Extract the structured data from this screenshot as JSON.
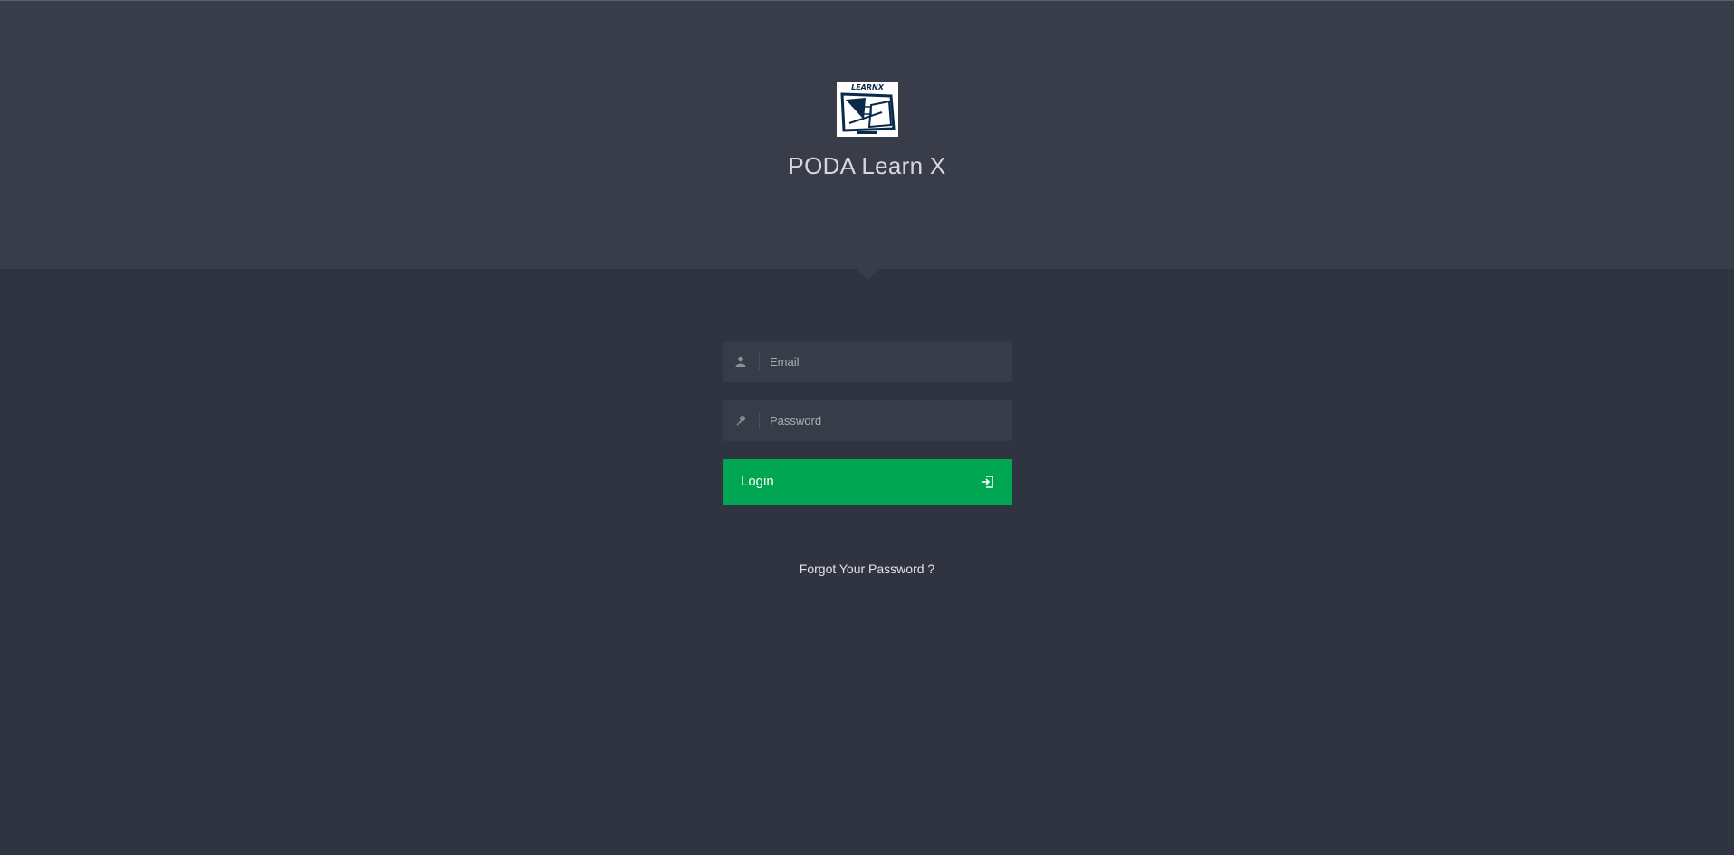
{
  "app": {
    "title": "PODA Learn X",
    "logo_text": "LEARNX"
  },
  "login_form": {
    "email_placeholder": "Email",
    "email_value": "",
    "password_placeholder": "Password",
    "password_value": "",
    "login_label": "Login",
    "forgot_label": "Forgot Your Password ?"
  },
  "icons": {
    "email": "user-icon",
    "password": "key-icon",
    "login": "sign-in-icon"
  },
  "colors": {
    "background": "#303440",
    "header": "#393d4a",
    "button": "#00a651",
    "field": "#383c48"
  }
}
